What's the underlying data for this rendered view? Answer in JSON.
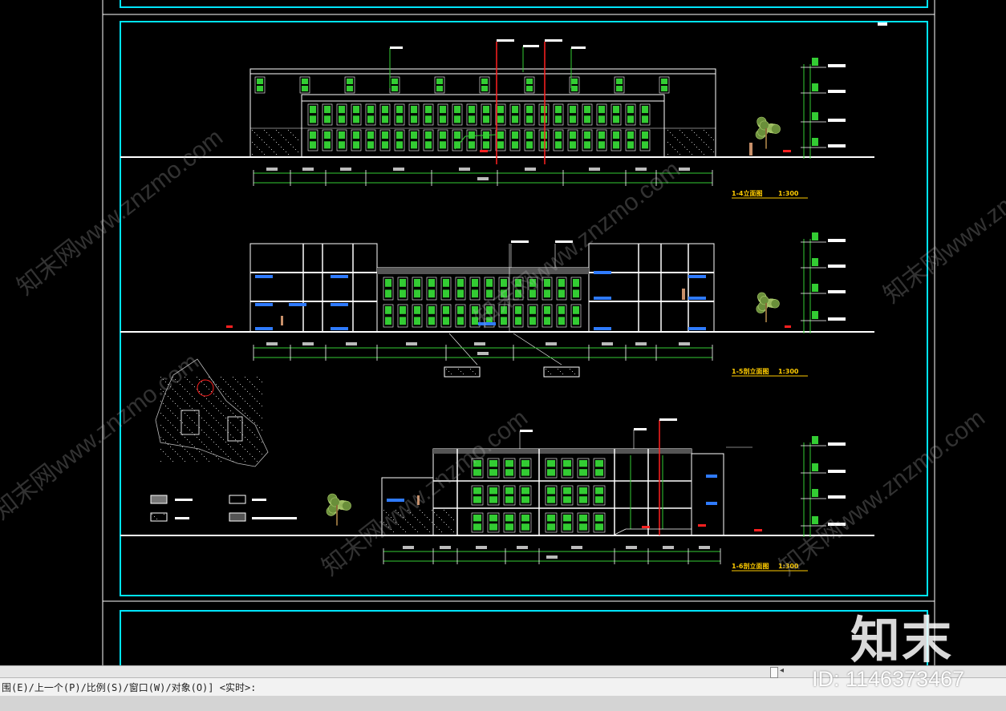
{
  "app": {
    "command_line": "围(E)/上一个(P)/比例(S)/窗口(W)/对象(O)] <实时>:"
  },
  "drawing": {
    "views": [
      {
        "title": "1-4立面图",
        "scale": "1:300"
      },
      {
        "title": "1-5剖立面图",
        "scale": "1:300"
      },
      {
        "title": "1-6剖立面图",
        "scale": "1:300"
      }
    ]
  },
  "watermark": {
    "logo": "知末",
    "id_text": "ID: 1146373467",
    "diagonal_text": "知末网www.znzmo.com"
  },
  "colors": {
    "background": "#000000",
    "frame": "#00e5ff",
    "structure": "#ffffff",
    "windows": "#33cc33",
    "annotation_red": "#ff2020",
    "title_yellow": "#ffcc00",
    "labels_blue": "#2f7bff",
    "command_bar": "#d4d4d4"
  }
}
